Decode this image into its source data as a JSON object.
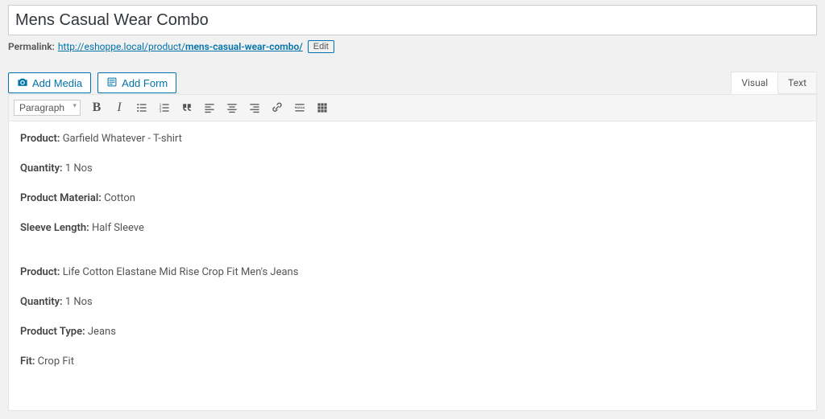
{
  "title": "Mens Casual Wear Combo",
  "permalink": {
    "label": "Permalink:",
    "base": "http://eshoppe.local/product/",
    "slug": "mens-casual-wear-combo/",
    "edit_label": "Edit"
  },
  "buttons": {
    "add_media": "Add Media",
    "add_form": "Add Form"
  },
  "tabs": {
    "visual": "Visual",
    "text": "Text"
  },
  "toolbar": {
    "format_label": "Paragraph"
  },
  "content": {
    "items": [
      {
        "labels": [
          "Product:",
          "Quantity:",
          "Product Material:",
          "Sleeve Length:"
        ],
        "values": [
          "Garfield Whatever - T-shirt",
          "1 Nos",
          "Cotton",
          "Half Sleeve"
        ]
      },
      {
        "labels": [
          "Product:",
          "Quantity:",
          "Product Type:",
          "Fit:"
        ],
        "values": [
          "Life Cotton Elastane Mid Rise Crop Fit Men's Jeans",
          "1 Nos",
          "Jeans",
          "Crop Fit"
        ]
      }
    ]
  }
}
